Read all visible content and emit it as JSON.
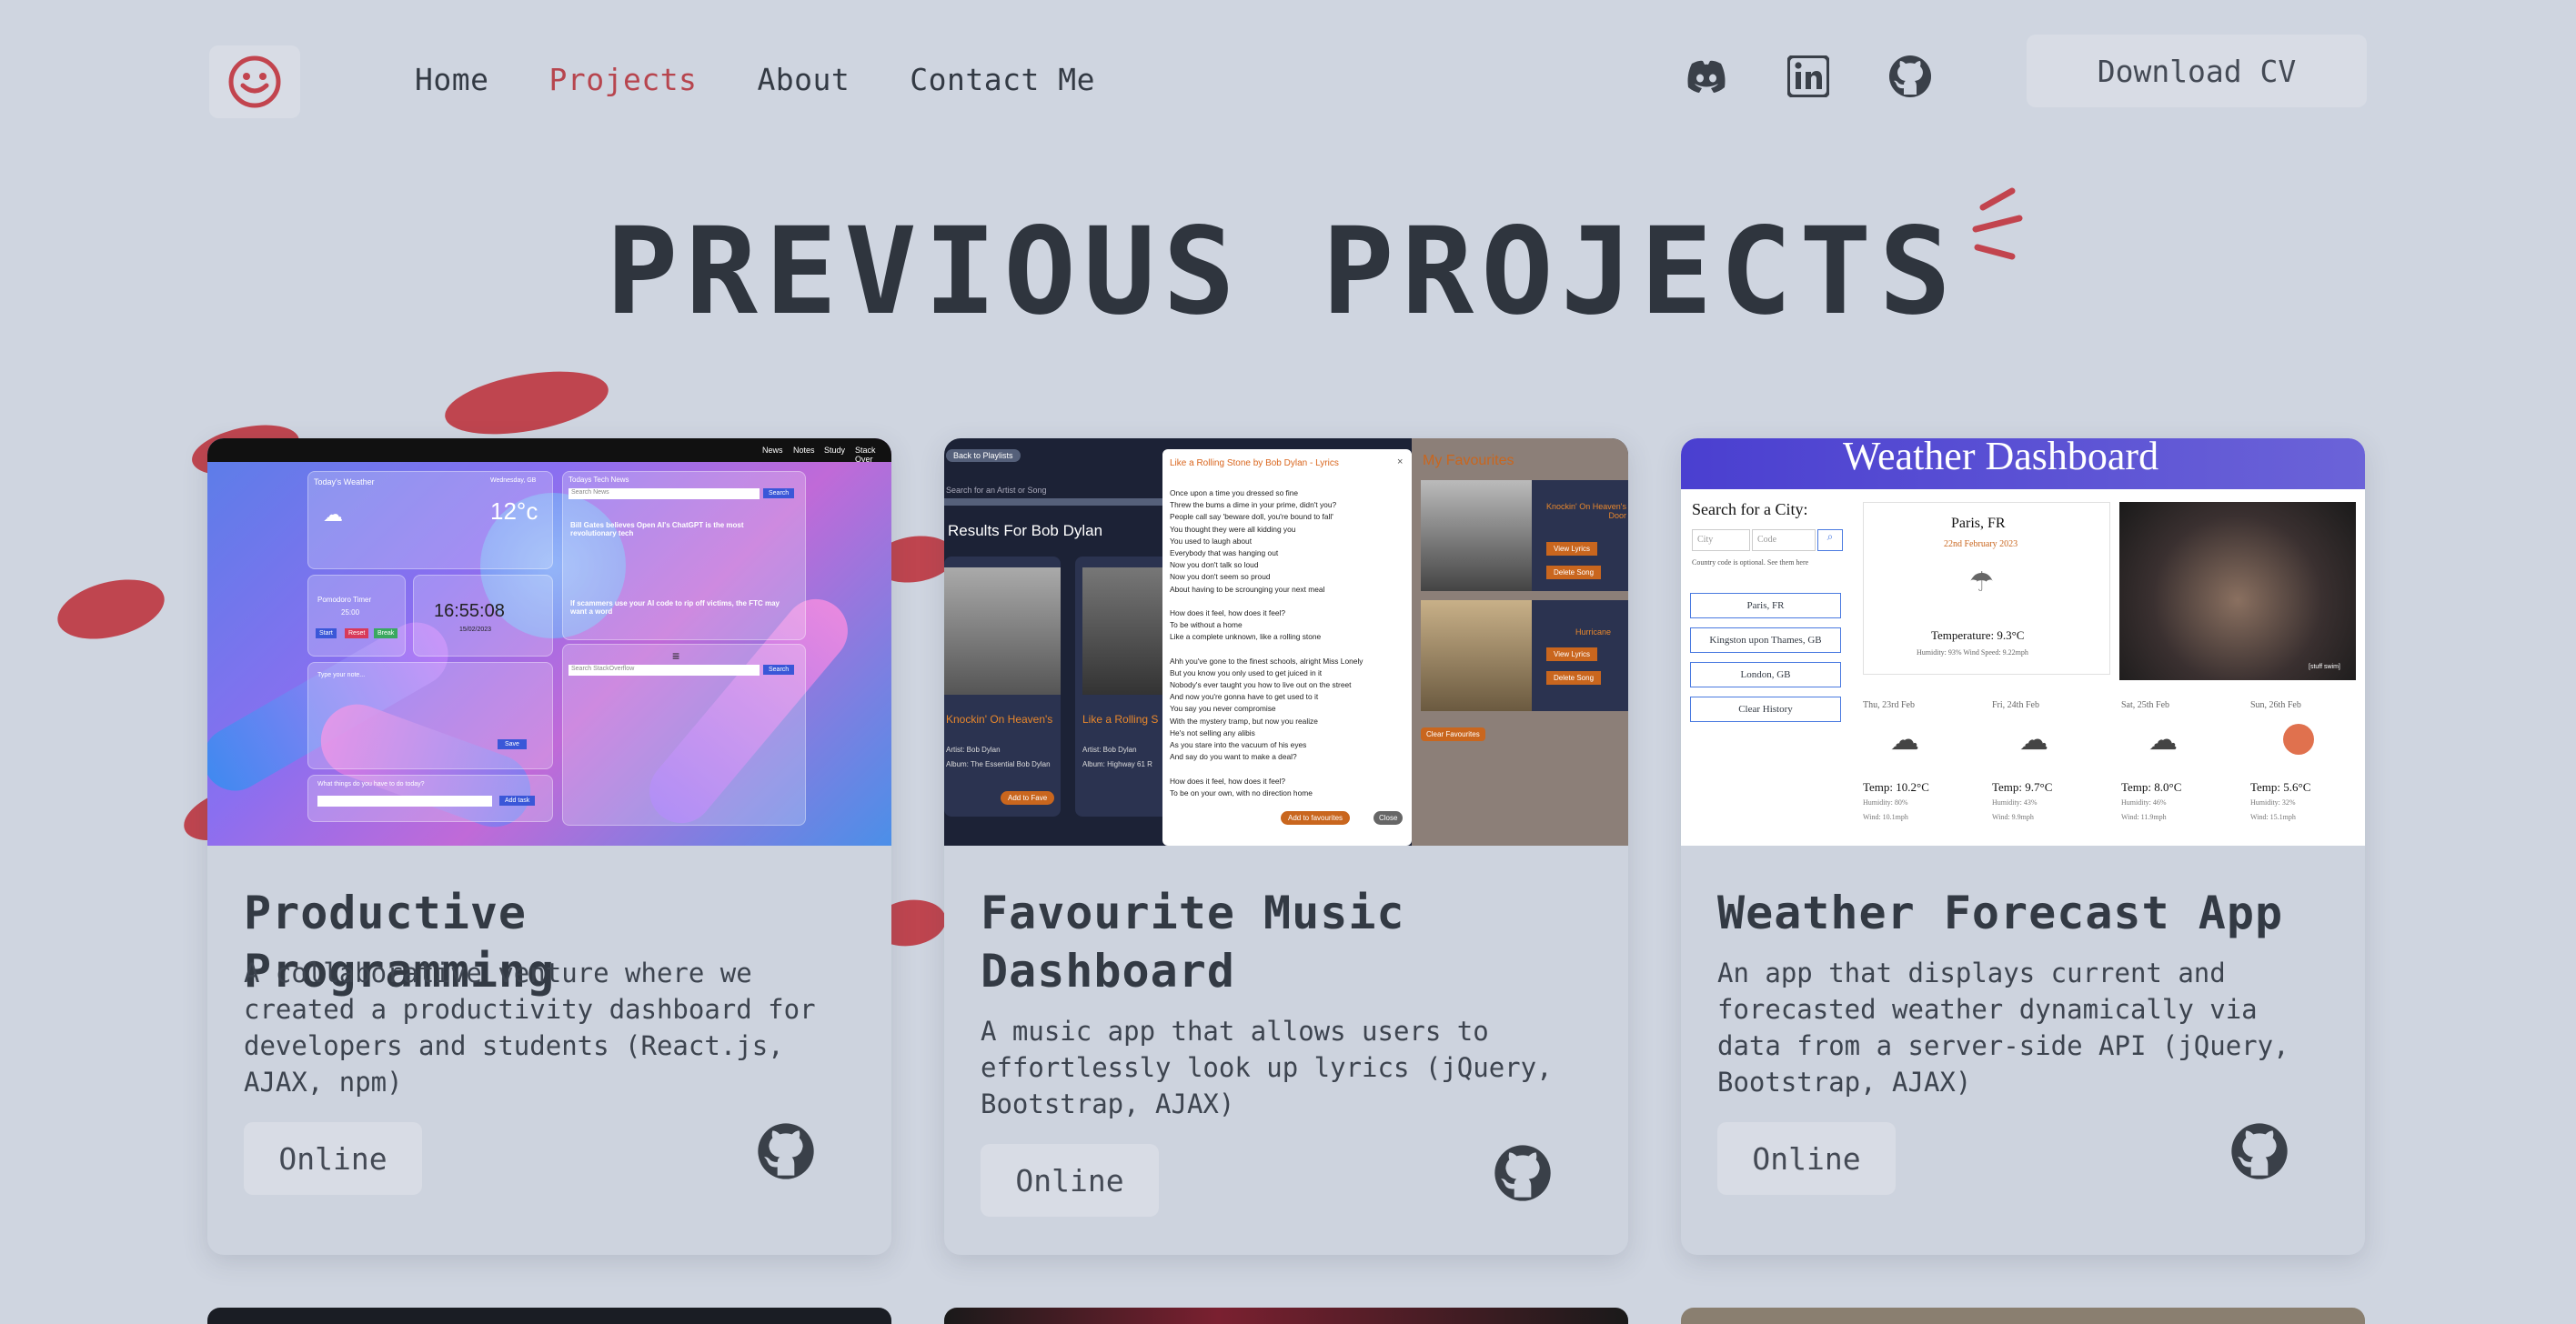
{
  "header": {
    "logo_icon": "smiley-icon",
    "nav": [
      {
        "label": "Home",
        "active": false
      },
      {
        "label": "Projects",
        "active": true
      },
      {
        "label": "About",
        "active": false
      },
      {
        "label": "Contact Me",
        "active": false
      }
    ],
    "social_icons": [
      "discord-icon",
      "linkedin-icon",
      "github-icon"
    ],
    "cv_button": "Download CV"
  },
  "page_title": "PREVIOUS PROJECTS",
  "colors": {
    "background": "#cfd5e0",
    "accent": "#bf454f",
    "text": "#333a44",
    "button": "#d8dce5"
  },
  "projects": [
    {
      "title": "Productive Programming",
      "description": "A collaborative venture where we created a productivity dashboard for developers and students (React.js, AJAX, npm)",
      "button": "Online",
      "screenshot": {
        "nav": [
          "News",
          "Notes",
          "Study",
          "Stack Over"
        ],
        "weather_title": "Today's Weather",
        "weather_date": "Wednesday, GB",
        "temp": "12°c",
        "pomodoro": "Pomodoro Timer",
        "timer": "25:00",
        "clock": "16:55:08",
        "date": "15/02/2023",
        "timer_buttons": [
          "Start",
          "Reset",
          "Break"
        ],
        "tech_news": "Todays Tech News",
        "search_news": "Search News",
        "search_btn": "Search",
        "headline1": "Bill Gates believes Open AI's ChatGPT is the most revolutionary tech",
        "headline2": "If scammers use your AI code to rip off victims, the FTC may want a word",
        "notes_placeholder": "Type your note...",
        "save": "Save",
        "todo_prompt": "What things do you have to do today?",
        "add_task": "Add task",
        "search_stack": "Search StackOverflow"
      }
    },
    {
      "title": "Favourite Music Dashboard",
      "description": "A music app that allows users to effortlessly look up lyrics (jQuery, Bootstrap, AJAX)",
      "button": "Online",
      "screenshot": {
        "back": "Back to Playlists",
        "search": "Search for an Artist or Song",
        "results": "Results For Bob Dylan",
        "modal_title": "Like a Rolling Stone by Bob Dylan - Lyrics",
        "lyrics": [
          "Once upon a time you dressed so fine",
          "Threw the bums a dime in your prime, didn't you?",
          "People call say 'beware doll, you're bound to fall'",
          "You thought they were all kidding you",
          "You used to laugh about",
          "Everybody that was hanging out",
          "Now you don't talk so loud",
          "Now you don't seem so proud",
          "About having to be scrounging your next meal",
          "",
          "How does it feel, how does it feel?",
          "To be without a home",
          "Like a complete unknown, like a rolling stone",
          "",
          "Ahh you've gone to the finest schools, alright Miss Lonely",
          "But you know you only used to get juiced in it",
          "Nobody's ever taught you how to live out on the street",
          "And now you're gonna have to get used to it",
          "You say you never compromise",
          "With the mystery tramp, but now you realize",
          "He's not selling any alibis",
          "As you stare into the vacuum of his eyes",
          "And say do you want to make a deal?",
          "",
          "How does it feel, how does it feel?",
          "To be on your own, with no direction home"
        ],
        "add_fav": "Add to favourites",
        "close": "Close",
        "favourites": "My Favourites",
        "fav1": "Knockin' On Heaven's Door",
        "fav2": "Hurricane",
        "view_lyrics": "View Lyrics",
        "delete_song": "Delete Song",
        "clear_fav": "Clear Favourites",
        "card1": "Knockin' On Heaven's",
        "card2": "Like a Rolling S",
        "artist": "Artist: Bob Dylan",
        "album1": "Album: The Essential Bob Dylan",
        "album2": "Album: Highway 61 R",
        "add_to_fave": "Add to Fave"
      }
    },
    {
      "title": "Weather Forecast App",
      "description": "An app that displays current and forecasted weather dynamically via data from a server-side API (jQuery, Bootstrap, AJAX)",
      "button": "Online",
      "screenshot": {
        "header": "Weather Dashboard",
        "search_label": "Search for a City:",
        "city_ph": "City",
        "code_ph": "Code",
        "hint": "Country code is optional. See them here",
        "history": [
          "Paris, FR",
          "Kingston upon Thames, GB",
          "London, GB"
        ],
        "clear_history": "Clear History",
        "current_city": "Paris, FR",
        "current_date": "22nd February 2023",
        "current_temp": "Temperature: 9.3°C",
        "current_details": "Humidity: 93% Wind Speed: 9.22mph",
        "gif_caption": "[stuff swim]",
        "forecast": [
          {
            "day": "Thu, 23rd Feb",
            "temp": "Temp: 10.2°C",
            "hum": "Humidity: 80%",
            "wind": "Wind: 10.1mph"
          },
          {
            "day": "Fri, 24th Feb",
            "temp": "Temp: 9.7°C",
            "hum": "Humidity: 43%",
            "wind": "Wind: 9.9mph"
          },
          {
            "day": "Sat, 25th Feb",
            "temp": "Temp: 8.0°C",
            "hum": "Humidity: 46%",
            "wind": "Wind: 11.9mph"
          },
          {
            "day": "Sun, 26th Feb",
            "temp": "Temp: 5.6°C",
            "hum": "Humidity: 32%",
            "wind": "Wind: 15.1mph"
          }
        ]
      }
    }
  ]
}
